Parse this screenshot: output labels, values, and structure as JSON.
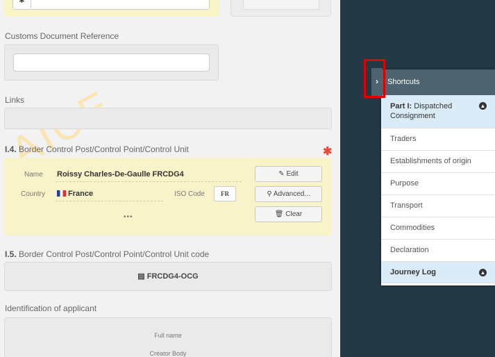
{
  "form": {
    "customs_doc_label": "Customs Document Reference",
    "links_label": "Links",
    "bcp_section": {
      "number": "I.4.",
      "title": "Border Control Post/Control Point/Control Unit",
      "name_label": "Name",
      "name_value": "Roissy Charles-De-Gaulle FRCDG4",
      "country_label": "Country",
      "country_value": "France",
      "iso_label": "ISO Code",
      "iso_value": "FR",
      "more": "•••",
      "edit_button": "Edit",
      "advanced_button": "Advanced...",
      "clear_button": "Clear",
      "required_mark": "✱"
    },
    "bcp_code_section": {
      "number": "I.5.",
      "title": "Border Control Post/Control Point/Control Unit code",
      "code_value": "FRCDG4-OCG"
    },
    "applicant_section": {
      "title": "Identification of applicant",
      "full_name_label": "Full name",
      "creator_body_label": "Creator Body"
    }
  },
  "shortcuts": {
    "header": "Shortcuts",
    "toggle_icon": "chevron-right-icon",
    "items": [
      {
        "bold": "Part I:",
        "label": "Dispatched Consignment",
        "active": true,
        "icon": "circle-up-icon"
      },
      {
        "label": "Traders"
      },
      {
        "label": "Establishments of origin"
      },
      {
        "label": "Purpose"
      },
      {
        "label": "Transport"
      },
      {
        "label": "Commodities"
      },
      {
        "label": "Declaration"
      },
      {
        "bold": "Journey Log",
        "label": "",
        "active": true,
        "icon": "circle-up-icon"
      }
    ]
  },
  "colors": {
    "background_dark": "#243845",
    "highlight_red": "#e00000",
    "panel_header": "#4d6470",
    "active_item": "#d9ecf7",
    "yellow_panel": "#f8f3c8"
  }
}
